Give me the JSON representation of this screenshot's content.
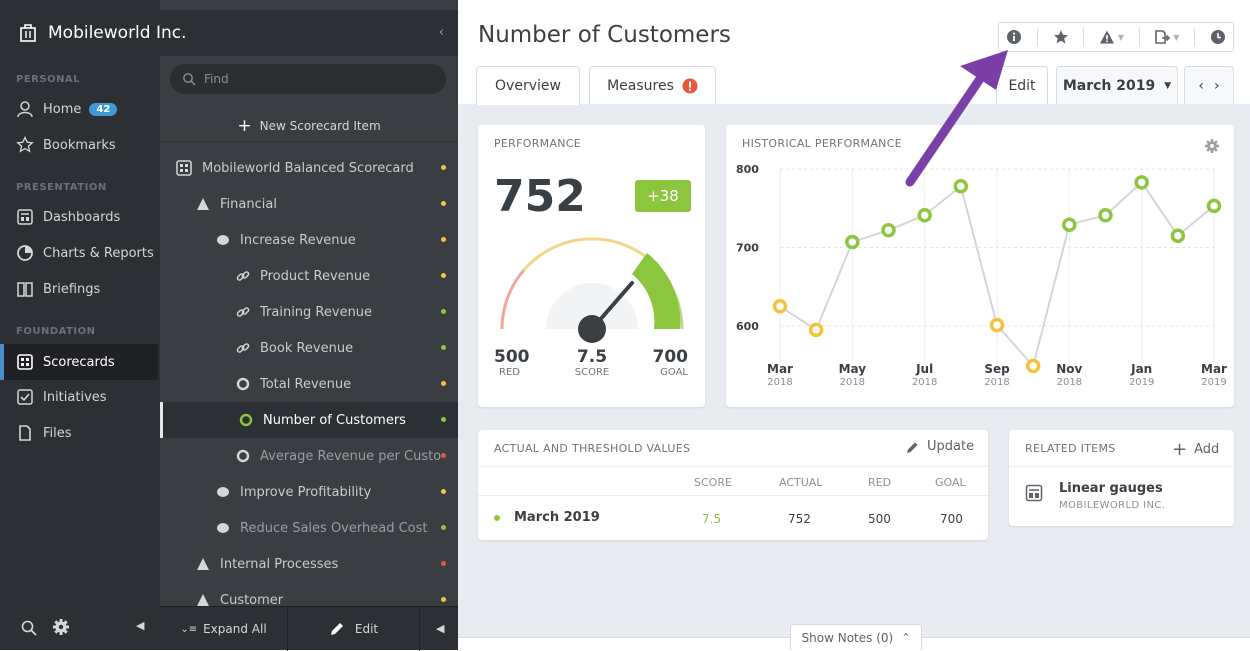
{
  "app": {
    "org_name": "Mobileworld Inc."
  },
  "nav": {
    "sections": {
      "personal": "PERSONAL",
      "presentation": "PRESENTATION",
      "foundation": "FOUNDATION"
    },
    "items": [
      {
        "label": "Home",
        "badge": "42"
      },
      {
        "label": "Bookmarks"
      },
      {
        "label": "Dashboards"
      },
      {
        "label": "Charts & Reports"
      },
      {
        "label": "Briefings"
      },
      {
        "label": "Scorecards"
      },
      {
        "label": "Initiatives"
      },
      {
        "label": "Files"
      }
    ]
  },
  "tree": {
    "search_placeholder": "Find",
    "new_item_label": "New Scorecard Item",
    "rows": [
      {
        "label": "Mobileworld Balanced Scorecard",
        "status": "#f5c33b"
      },
      {
        "label": "Financial",
        "status": "#f5c33b"
      },
      {
        "label": "Increase Revenue",
        "status": "#f5c33b"
      },
      {
        "label": "Product Revenue",
        "status": "#f5c33b"
      },
      {
        "label": "Training Revenue",
        "status": "#8cc63f"
      },
      {
        "label": "Book Revenue",
        "status": "#8cc63f"
      },
      {
        "label": "Total Revenue",
        "status": "#f5c33b"
      },
      {
        "label": "Number of Customers",
        "status": "#8cc63f"
      },
      {
        "label": "Average Revenue per Custo",
        "status": "#e9573f"
      },
      {
        "label": "Improve Profitability",
        "status": "#f5c33b"
      },
      {
        "label": "Reduce Sales Overhead Cost",
        "status": "#8cc63f"
      },
      {
        "label": "Internal Processes",
        "status": "#e9573f"
      },
      {
        "label": "Customer",
        "status": "#f5c33b"
      }
    ],
    "footer": {
      "expand_label": "Expand All",
      "edit_label": "Edit"
    }
  },
  "main": {
    "title": "Number of Customers",
    "tabs": {
      "overview": "Overview",
      "measures": "Measures"
    },
    "edit_label": "Edit",
    "period_label": "March 2019",
    "performance": {
      "title": "PERFORMANCE",
      "value": "752",
      "change": "+38",
      "red_value": "500",
      "red_label": "RED",
      "score_value": "7.5",
      "score_label": "SCORE",
      "goal_value": "700",
      "goal_label": "GOAL"
    },
    "historical": {
      "title": "HISTORICAL PERFORMANCE"
    },
    "actuals": {
      "title": "ACTUAL AND THRESHOLD VALUES",
      "update_label": "Update",
      "headers": {
        "score": "SCORE",
        "actual": "ACTUAL",
        "red": "RED",
        "goal": "GOAL"
      },
      "row": {
        "period": "March 2019",
        "score": "7.5",
        "actual": "752",
        "red": "500",
        "goal": "700"
      }
    },
    "related": {
      "title": "RELATED ITEMS",
      "add_label": "Add",
      "item_title": "Linear gauges",
      "item_sub": "MOBILEWORLD INC."
    },
    "notes_label": "Show Notes (0)"
  },
  "colors": {
    "green": "#8cc63f",
    "yellow": "#f5c33b",
    "red": "#e9573f",
    "accent": "#3d9ad6",
    "arrow": "#7b3fa8"
  },
  "chart_data": {
    "type": "line",
    "title": "HISTORICAL PERFORMANCE",
    "x": [
      "Mar 2018",
      "Apr 2018",
      "May 2018",
      "Jun 2018",
      "Jul 2018",
      "Aug 2018",
      "Sep 2018",
      "Oct 2018",
      "Nov 2018",
      "Dec 2018",
      "Jan 2019",
      "Feb 2019",
      "Mar 2019"
    ],
    "x_tick_labels": [
      [
        "Mar",
        "2018"
      ],
      [
        "May",
        "2018"
      ],
      [
        "Jul",
        "2018"
      ],
      [
        "Sep",
        "2018"
      ],
      [
        "Nov",
        "2018"
      ],
      [
        "Jan",
        "2019"
      ],
      [
        "Mar",
        "2019"
      ]
    ],
    "y_ticks": [
      "800",
      "700",
      "600"
    ],
    "values": [
      625,
      595,
      707,
      722,
      741,
      778,
      601,
      549,
      729,
      741,
      783,
      715,
      753
    ],
    "point_status": [
      "yellow",
      "yellow",
      "green",
      "green",
      "green",
      "green",
      "yellow",
      "yellow",
      "green",
      "green",
      "green",
      "green",
      "green"
    ],
    "ylim": [
      540,
      800
    ],
    "grid": true
  }
}
